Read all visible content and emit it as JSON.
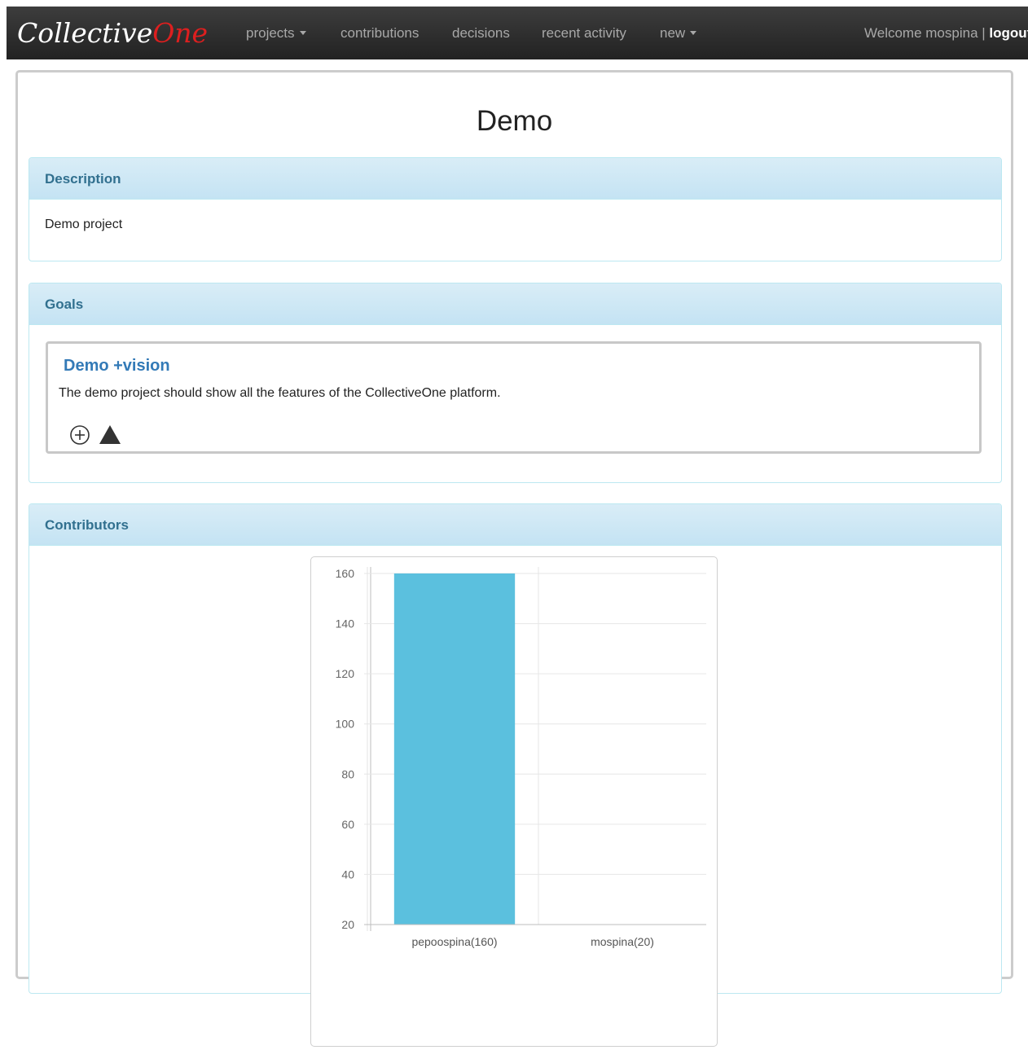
{
  "navbar": {
    "brand_main": "Collective",
    "brand_accent": "One",
    "items": [
      {
        "label": "projects",
        "dropdown": true
      },
      {
        "label": "contributions",
        "dropdown": false
      },
      {
        "label": "decisions",
        "dropdown": false
      },
      {
        "label": "recent activity",
        "dropdown": false
      },
      {
        "label": "new",
        "dropdown": true
      }
    ],
    "welcome_text": "Welcome mospina | ",
    "logout_label": "logout"
  },
  "page": {
    "title": "Demo"
  },
  "description_panel": {
    "heading": "Description",
    "text": "Demo project"
  },
  "goals_panel": {
    "heading": "Goals",
    "goal": {
      "title": "Demo +vision",
      "description": "The demo project should show all the features of the CollectiveOne platform.",
      "icons": [
        "circle-plus-icon",
        "triangle-up-icon"
      ]
    }
  },
  "contributors_panel": {
    "heading": "Contributors"
  },
  "chart_data": {
    "type": "bar",
    "categories": [
      "pepoospina(160)",
      "mospina(20)"
    ],
    "values": [
      160,
      20
    ],
    "y_ticks": [
      160,
      140,
      120,
      100,
      80,
      60,
      40,
      20
    ],
    "ylim": [
      20,
      160
    ],
    "grid": true,
    "color": "#5bc0de"
  },
  "colors": {
    "navbar_bg": "#222222",
    "brand_accent": "#dd1f1f",
    "link": "#337ab7",
    "panel_heading_text": "#31708f",
    "bar": "#5bc0de"
  }
}
